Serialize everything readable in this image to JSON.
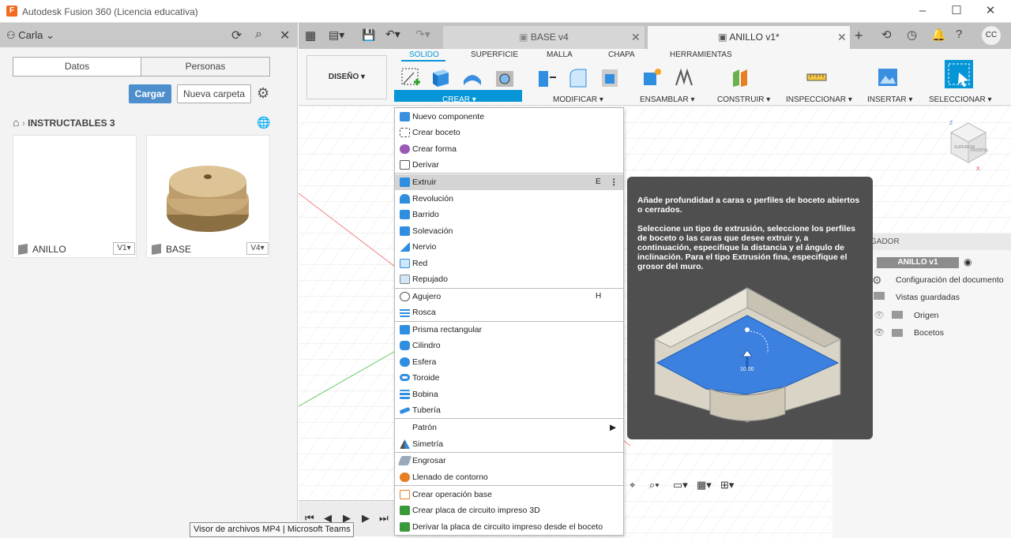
{
  "window": {
    "app_icon": "F",
    "title": "Autodesk Fusion 360 (Licencia educativa)",
    "minimize_icon": "minimize-icon",
    "maximize_icon": "maximize-icon",
    "close_icon": "close-icon"
  },
  "left_panel": {
    "user": "Carla",
    "tabs": [
      "Datos",
      "Personas"
    ],
    "upload_label": "Cargar",
    "new_folder_label": "Nueva carpeta",
    "breadcrumb": "INSTRUCTABLES 3",
    "files": [
      {
        "name": "ANILLO",
        "version": "V1▾"
      },
      {
        "name": "BASE",
        "version": "V4▾"
      }
    ]
  },
  "tabs": [
    {
      "label": "BASE v4",
      "active": false
    },
    {
      "label": "ANILLO v1*",
      "active": true
    }
  ],
  "toolbar": {
    "workspace": "DISEÑO ▾",
    "tabs": [
      "SOLIDO",
      "SUPERFICIE",
      "MALLA",
      "CHAPA",
      "HERRAMIENTAS"
    ],
    "groups": [
      "CREAR ▾",
      "MODIFICAR ▾",
      "ENSAMBLAR ▾",
      "CONSTRUIR ▾",
      "INSPECCIONAR ▾",
      "INSERTAR ▾",
      "SELECCIONAR ▾"
    ]
  },
  "menu": {
    "items": [
      {
        "label": "Nuevo componente",
        "shortcut": ""
      },
      {
        "label": "Crear boceto",
        "shortcut": ""
      },
      {
        "label": "Crear forma",
        "shortcut": ""
      },
      {
        "label": "Derivar",
        "shortcut": ""
      },
      {
        "label": "Extruir",
        "shortcut": "E"
      },
      {
        "label": "Revolución",
        "shortcut": ""
      },
      {
        "label": "Barrido",
        "shortcut": ""
      },
      {
        "label": "Solevación",
        "shortcut": ""
      },
      {
        "label": "Nervio",
        "shortcut": ""
      },
      {
        "label": "Red",
        "shortcut": ""
      },
      {
        "label": "Repujado",
        "shortcut": ""
      },
      {
        "label": "Agujero",
        "shortcut": "H"
      },
      {
        "label": "Rosca",
        "shortcut": ""
      },
      {
        "label": "Prisma rectangular",
        "shortcut": ""
      },
      {
        "label": "Cilindro",
        "shortcut": ""
      },
      {
        "label": "Esfera",
        "shortcut": ""
      },
      {
        "label": "Toroide",
        "shortcut": ""
      },
      {
        "label": "Bobina",
        "shortcut": ""
      },
      {
        "label": "Tubería",
        "shortcut": ""
      },
      {
        "label": "Patrón",
        "shortcut": ""
      },
      {
        "label": "Simetría",
        "shortcut": ""
      },
      {
        "label": "Engrosar",
        "shortcut": ""
      },
      {
        "label": "Llenado de contorno",
        "shortcut": ""
      },
      {
        "label": "Crear operación base",
        "shortcut": ""
      },
      {
        "label": "Crear placa de circuito impreso 3D",
        "shortcut": ""
      },
      {
        "label": "Derivar la placa de circuito impreso desde el boceto",
        "shortcut": ""
      }
    ]
  },
  "tooltip": {
    "line1": "Añade profundidad a caras o perfiles de boceto abiertos o cerrados.",
    "line2": "Seleccione un tipo de extrusión, seleccione los perfiles de boceto o las caras que desee extruir y, a continuación, especifique la distancia y el ángulo de inclinación. Para el tipo Extrusión fina, especifique el grosor del muro.",
    "dimension": "10.00"
  },
  "browser": {
    "header": "GADOR",
    "root": "ANILLO v1",
    "items": [
      "Configuración del documento",
      "Vistas guardadas",
      "Origen",
      "Bocetos"
    ]
  },
  "viewcube": {
    "front": "FRONTAL",
    "top": "SUPERIOR",
    "z_axis": "Z",
    "x_axis": "X"
  },
  "status": {
    "text": "Visor de archivos MP4 | Microsoft Teams"
  },
  "colors": {
    "accent": "#0696d7",
    "upload": "#4d8fcc",
    "tooltip_bg": "#4f4f4f",
    "extrude_blue": "#3c80e0"
  }
}
